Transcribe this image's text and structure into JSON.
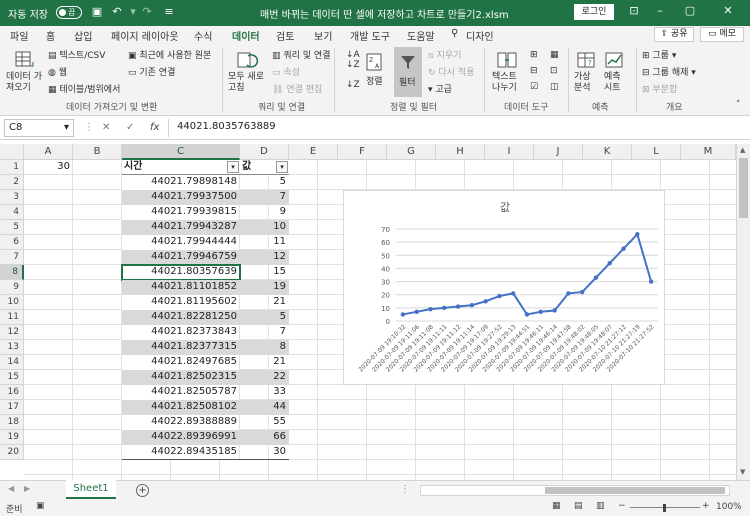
{
  "titlebar": {
    "autosave_label": "자동 저장",
    "autosave_state": "끔",
    "title": "매번 바뀌는 데이터 딴 셀에 저장하고 차트로 만들기2.xlsm",
    "login": "로그인"
  },
  "menu": {
    "tabs": [
      "파일",
      "홈",
      "삽입",
      "페이지 레이아웃",
      "수식",
      "데이터",
      "검토",
      "보기",
      "개발 도구",
      "도움말",
      "디자인"
    ],
    "active": "데이터",
    "share": "공유",
    "memo": "메모"
  },
  "ribbon": {
    "get_data": "데이터 가져오기",
    "from_text_csv": "텍스트/CSV",
    "from_web": "웹",
    "from_table": "테이블/범위에서",
    "recent_sources": "최근에 사용한 원본",
    "existing_connections": "기존 연결",
    "group_get_transform": "데이터 가져오기 및 변환",
    "refresh_all": "모두 새로 고침",
    "queries_connections": "쿼리 및 연결",
    "properties": "속성",
    "edit_links": "연결 편집",
    "group_queries": "쿼리 및 연결",
    "sort": "정렬",
    "filter": "필터",
    "clear": "지우기",
    "reapply": "다시 적용",
    "advanced": "고급",
    "group_sort_filter": "정렬 및 필터",
    "text_to_columns": "텍스트 나누기",
    "group_data_tools": "데이터 도구",
    "what_if": "가상 분석",
    "forecast_sheet": "예측 시트",
    "group_forecast": "예측",
    "group": "그룹",
    "ungroup": "그룹 해제",
    "subtotal": "부분합",
    "group_outline": "개요"
  },
  "formula_bar": {
    "name_box": "C8",
    "formula": "44021.8035763889"
  },
  "columns": [
    "A",
    "B",
    "C",
    "D",
    "E",
    "F",
    "G",
    "H",
    "I",
    "J",
    "K",
    "L",
    "M"
  ],
  "rows": [
    "1",
    "2",
    "3",
    "4",
    "5",
    "6",
    "7",
    "8",
    "9",
    "10",
    "11",
    "12",
    "13",
    "14",
    "15",
    "16",
    "17",
    "18",
    "19",
    "20"
  ],
  "sheet": {
    "a1": "30",
    "c_header": "시간",
    "d_header": "값",
    "time_values": [
      "44021.79898148",
      "44021.79937500",
      "44021.79939815",
      "44021.79943287",
      "44021.79944444",
      "44021.79946759",
      "44021.80357639",
      "44021.81101852",
      "44021.81195602",
      "44021.82281250",
      "44021.82373843",
      "44021.82377315",
      "44021.82497685",
      "44021.82502315",
      "44021.82505787",
      "44021.82508102",
      "44022.89388889",
      "44022.89396991",
      "44022.89435185"
    ],
    "values": [
      "5",
      "7",
      "9",
      "10",
      "11",
      "12",
      "15",
      "19",
      "21",
      "5",
      "7",
      "8",
      "21",
      "22",
      "33",
      "44",
      "55",
      "66",
      "30"
    ]
  },
  "chart_data": {
    "type": "line",
    "title": "값",
    "categories": [
      "2020-07-09 19:10:32",
      "2020-07-09 19:11:06",
      "2020-07-09 19:11:08",
      "2020-07-09 19:11:11",
      "2020-07-09 19:11:12",
      "2020-07-09 19:11:14",
      "2020-07-09 19:17:09",
      "2020-07-09 19:27:52",
      "2020-07-09 19:29:13",
      "2020-07-09 19:44:51",
      "2020-07-09 19:46:11",
      "2020-07-09 19:46:14",
      "2020-07-09 19:47:58",
      "2020-07-09 19:48:02",
      "2020-07-09 19:48:05",
      "2020-07-09 19:48:07",
      "2020-07-10 21:27:12",
      "2020-07-10 21:27:19",
      "2020-07-10 21:27:52"
    ],
    "series": [
      {
        "values": [
          5,
          7,
          9,
          10,
          11,
          12,
          15,
          19,
          21,
          5,
          7,
          8,
          21,
          22,
          33,
          44,
          55,
          66,
          30
        ]
      }
    ],
    "ylim": [
      0,
      70
    ],
    "yticks": [
      "0",
      "10",
      "20",
      "30",
      "40",
      "50",
      "60",
      "70"
    ],
    "grid": true,
    "color": "#4472c4"
  },
  "tabs": {
    "sheet1": "Sheet1"
  },
  "status": {
    "ready": "준비",
    "zoom": "100%"
  }
}
